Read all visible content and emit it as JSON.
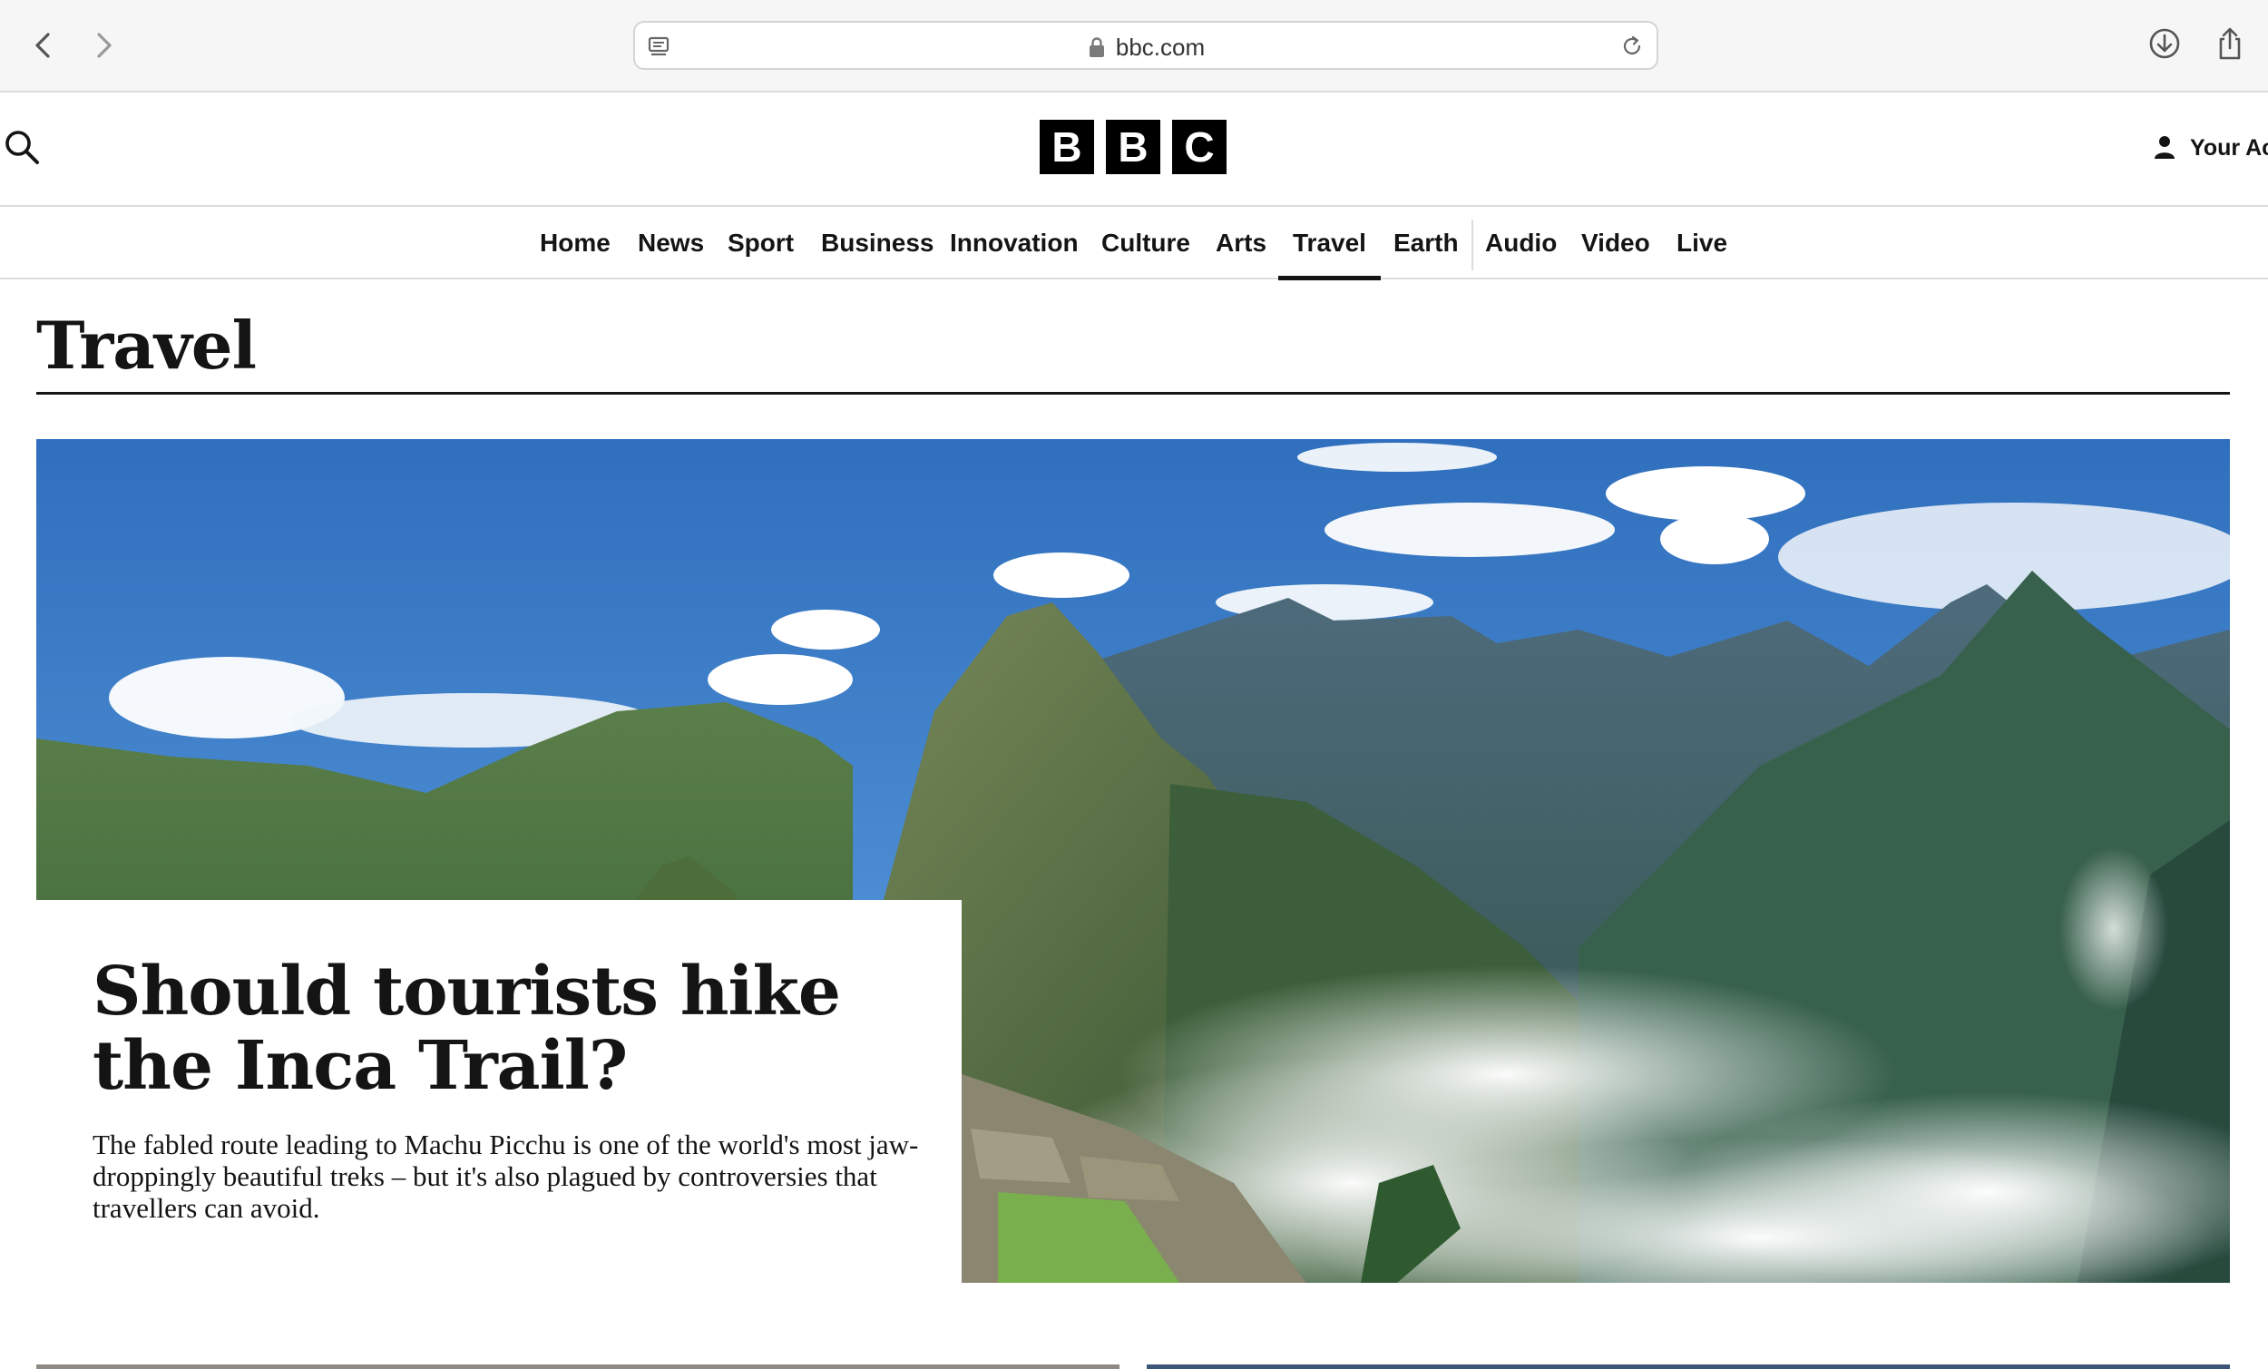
{
  "browser": {
    "url": "bbc.com",
    "icons": {
      "back": "chevron-left-icon",
      "forward": "chevron-right-icon",
      "tab": "tab-overview-icon",
      "lock": "lock-icon",
      "reload": "reload-icon",
      "download": "download-icon",
      "share": "share-icon"
    }
  },
  "header": {
    "logo_letters": [
      "B",
      "B",
      "C"
    ],
    "account_label": "Your Ac",
    "search_icon": "search-icon",
    "account_icon": "person-icon"
  },
  "nav": {
    "items": [
      {
        "label": "Home"
      },
      {
        "label": "News"
      },
      {
        "label": "Sport"
      },
      {
        "label": "Business"
      },
      {
        "label": "Innovation"
      },
      {
        "label": "Culture"
      },
      {
        "label": "Arts"
      },
      {
        "label": "Travel",
        "active": true
      },
      {
        "label": "Earth"
      },
      {
        "label": "Audio"
      },
      {
        "label": "Video"
      },
      {
        "label": "Live"
      }
    ]
  },
  "page": {
    "title": "Travel"
  },
  "hero": {
    "headline": "Should tourists hike the Inca Trail?",
    "summary": "The fabled route leading to Machu Picchu is one of the world's most jaw-droppingly beautiful treks – but it's also plagued by controversies that travellers can avoid.",
    "image_subject": "Machu Picchu and Huayna Picchu with clouds"
  },
  "colors": {
    "text": "#141414",
    "chrome_bg": "#f6f6f6",
    "divider": "#dcdcdc",
    "sky": "#3a7fc8",
    "mountain": "#3e6a46"
  }
}
